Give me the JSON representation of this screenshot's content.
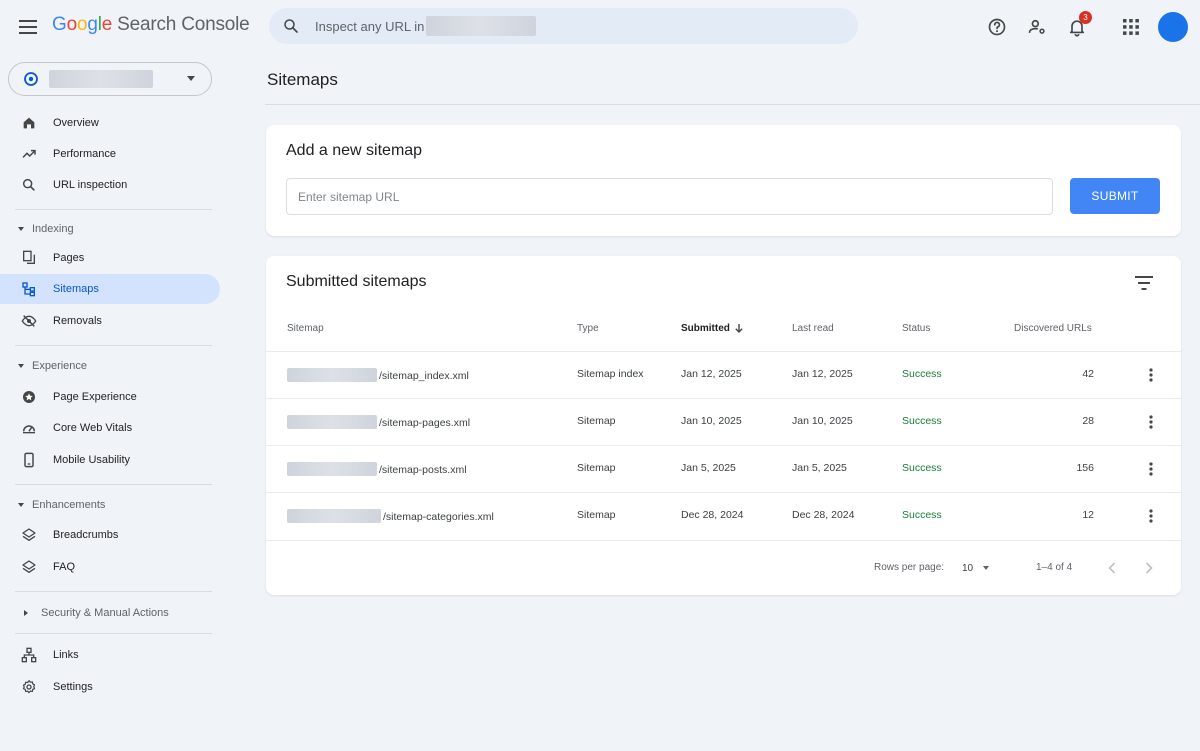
{
  "app": {
    "logo_part1": "G",
    "logo_part2": "o",
    "logo_part3": "o",
    "logo_part4": "g",
    "logo_part5": "l",
    "logo_part6": "e",
    "product": "Search Console",
    "search_placeholder": "Inspect any URL in",
    "notification_count": "3"
  },
  "sidebar": {
    "items": [
      {
        "label": "Overview",
        "icon": "home-icon"
      },
      {
        "label": "Performance",
        "icon": "trending-up-icon"
      },
      {
        "label": "URL inspection",
        "icon": "search-icon"
      }
    ],
    "indexing": {
      "title": "Indexing",
      "items": [
        {
          "label": "Pages",
          "icon": "pages-icon"
        },
        {
          "label": "Sitemaps",
          "icon": "sitemap-icon",
          "active": true
        },
        {
          "label": "Removals",
          "icon": "visibility-off-icon"
        }
      ]
    },
    "experience": {
      "title": "Experience",
      "items": [
        {
          "label": "Page Experience",
          "icon": "star-badge-icon"
        },
        {
          "label": "Core Web Vitals",
          "icon": "speed-icon"
        },
        {
          "label": "Mobile Usability",
          "icon": "smartphone-icon"
        }
      ]
    },
    "enhancements": {
      "title": "Enhancements",
      "items": [
        {
          "label": "Breadcrumbs",
          "icon": "layers-icon"
        },
        {
          "label": "FAQ",
          "icon": "layers-icon"
        }
      ]
    },
    "security": {
      "title": "Security & Manual Actions"
    },
    "bottom_items": [
      {
        "label": "Links",
        "icon": "links-icon"
      },
      {
        "label": "Settings",
        "icon": "settings-icon"
      }
    ]
  },
  "main": {
    "title": "Sitemaps",
    "add": {
      "title": "Add a new sitemap",
      "placeholder": "Enter sitemap URL",
      "submit_label": "SUBMIT"
    },
    "submitted": {
      "title": "Submitted sitemaps",
      "columns": [
        "Sitemap",
        "Type",
        "Submitted",
        "Last read",
        "Status",
        "Discovered URLs"
      ],
      "rows": [
        {
          "sitemap": "/sitemap_index.xml",
          "type": "Sitemap index",
          "submitted": "Jan 12, 2025",
          "last_read": "Jan 12, 2025",
          "status": "Success",
          "urls": "42"
        },
        {
          "sitemap": "/sitemap-pages.xml",
          "type": "Sitemap",
          "submitted": "Jan 10, 2025",
          "last_read": "Jan 10, 2025",
          "status": "Success",
          "urls": "28"
        },
        {
          "sitemap": "/sitemap-posts.xml",
          "type": "Sitemap",
          "submitted": "Jan 5, 2025",
          "last_read": "Jan 5, 2025",
          "status": "Success",
          "urls": "156"
        },
        {
          "sitemap": "/sitemap-categories.xml",
          "type": "Sitemap",
          "submitted": "Dec 28, 2024",
          "last_read": "Dec 28, 2024",
          "status": "Success",
          "urls": "12"
        }
      ],
      "rows_per_page_label": "Rows per page:",
      "rows_per_page": "10",
      "range": "1–4 of 4"
    }
  },
  "colors": {
    "accent": "#4285f4",
    "active_nav": "#d3e3fd",
    "success": "#188038",
    "background": "#f0f4f9"
  }
}
